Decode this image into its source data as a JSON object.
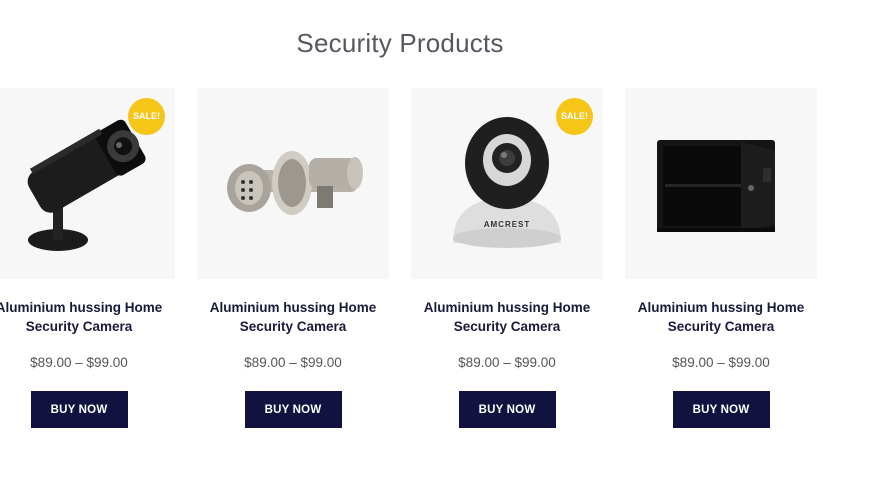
{
  "section": {
    "title": "Security Products"
  },
  "products": [
    {
      "image": "cctv-bullet-camera",
      "sale": "SALE!",
      "name": "Aluminium hussing Home Security Camera",
      "price_min": "$89.00",
      "price_sep": "–",
      "price_max": "$99.00",
      "button": "BUY NOW"
    },
    {
      "image": "keypad-door-lock",
      "sale": "",
      "name": "Aluminium hussing Home Security Camera",
      "price_min": "$89.00",
      "price_sep": "–",
      "price_max": "$99.00",
      "button": "BUY NOW"
    },
    {
      "image": "amcrest-dome-camera",
      "sale": "SALE!",
      "name": "Aluminium hussing Home Security Camera",
      "price_min": "$89.00",
      "price_sep": "–",
      "price_max": "$99.00",
      "button": "BUY NOW"
    },
    {
      "image": "black-safe",
      "sale": "",
      "name": "Aluminium hussing Home Security Camera",
      "price_min": "$89.00",
      "price_sep": "–",
      "price_max": "$99.00",
      "button": "BUY NOW"
    }
  ],
  "brand_marks": {
    "camera_logo": "AMCREST"
  },
  "colors": {
    "sale_badge": "#f5c518",
    "button_bg": "#111240",
    "title_text": "#555860",
    "product_name": "#1a1a3a"
  }
}
